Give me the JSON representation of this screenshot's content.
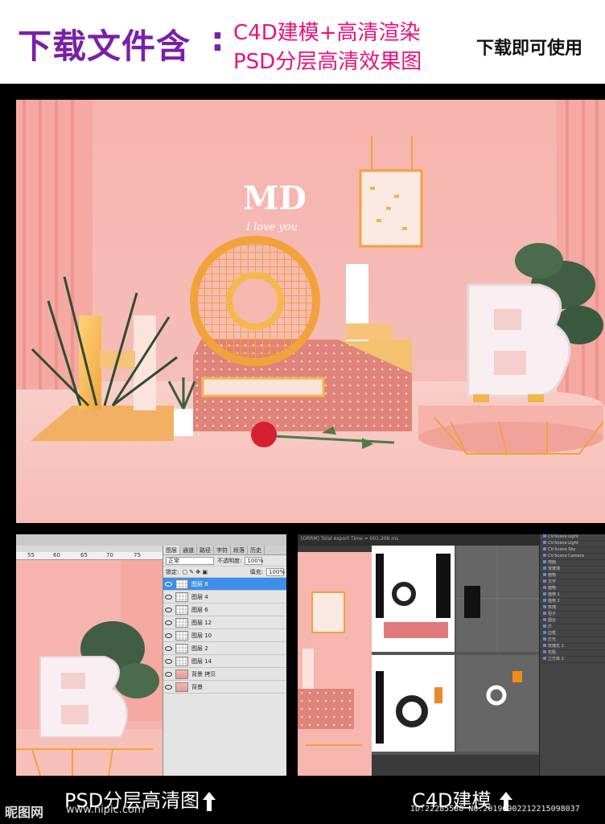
{
  "header": {
    "title": "下载文件含",
    "colon": ":",
    "line1": "C4D建模+高清渲染",
    "line2": "PSD分层高清效果图",
    "right": "下载即可使用"
  },
  "render": {
    "logo_text": "MD",
    "script_text": "I love you"
  },
  "ps": {
    "tabs": [
      "图层",
      "通道",
      "路径",
      "字符",
      "段落",
      "历史"
    ],
    "blend_mode": "正常",
    "opacity_label": "不透明度:",
    "opacity_value": "100%",
    "lock_label": "锁定:",
    "fill_label": "填充:",
    "fill_value": "100%",
    "ruler": [
      "55",
      "60",
      "65",
      "70",
      "75"
    ],
    "layers": [
      {
        "name": "图层 8",
        "selected": true
      },
      {
        "name": "图层 4"
      },
      {
        "name": "图层 6"
      },
      {
        "name": "图层 12"
      },
      {
        "name": "图层 10"
      },
      {
        "name": "图层 2"
      },
      {
        "name": "图层 14"
      },
      {
        "name": "背景 拷贝",
        "pic": true
      },
      {
        "name": "背景",
        "pic": true
      }
    ]
  },
  "c4d": {
    "title_bar": "[GRRM] Total export Time = 001.206 ms",
    "objects": [
      "CV-Scene Light",
      "CV-Scene Light",
      "CV-Scene Sky",
      "CV-Scene Camera",
      "地面",
      "背景墙",
      "植物",
      "文字",
      "植物",
      "植物 1",
      "植物 2",
      "玫瑰",
      "柜子",
      "圆台",
      "灯",
      "边框",
      "灯光",
      "玫瑰花 1",
      "花瓶",
      "立方体 2"
    ]
  },
  "footer": {
    "left_caption": "PSD分层高清图",
    "right_caption": "C4D建模",
    "watermark_logo": "昵图网",
    "watermark_url": "www.nipic.com",
    "watermark_id": "ID:22285588 NO:20190902212215098037"
  }
}
